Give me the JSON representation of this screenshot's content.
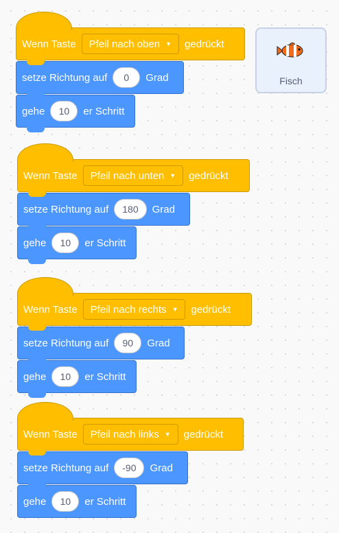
{
  "scripts": [
    {
      "event": {
        "prefix": "Wenn Taste",
        "key": "Pfeil nach oben",
        "suffix": "gedrückt"
      },
      "point": {
        "prefix": "setze Richtung auf",
        "value": "0",
        "suffix": "Grad"
      },
      "move": {
        "prefix": "gehe",
        "value": "10",
        "suffix": "er Schritt"
      }
    },
    {
      "event": {
        "prefix": "Wenn Taste",
        "key": "Pfeil nach unten",
        "suffix": "gedrückt"
      },
      "point": {
        "prefix": "setze Richtung auf",
        "value": "180",
        "suffix": "Grad"
      },
      "move": {
        "prefix": "gehe",
        "value": "10",
        "suffix": "er Schritt"
      }
    },
    {
      "event": {
        "prefix": "Wenn Taste",
        "key": "Pfeil nach rechts",
        "suffix": "gedrückt"
      },
      "point": {
        "prefix": "setze Richtung auf",
        "value": "90",
        "suffix": "Grad"
      },
      "move": {
        "prefix": "gehe",
        "value": "10",
        "suffix": "er Schritt"
      }
    },
    {
      "event": {
        "prefix": "Wenn Taste",
        "key": "Pfeil nach links",
        "suffix": "gedrückt"
      },
      "point": {
        "prefix": "setze Richtung auf",
        "value": "-90",
        "suffix": "Grad"
      },
      "move": {
        "prefix": "gehe",
        "value": "10",
        "suffix": "er Schritt"
      }
    }
  ],
  "sprite": {
    "name": "Fisch",
    "icon": "clownfish-icon"
  },
  "colors": {
    "events": "#ffbf00",
    "motion": "#4c97ff",
    "workspace": "#f9f9f9"
  }
}
